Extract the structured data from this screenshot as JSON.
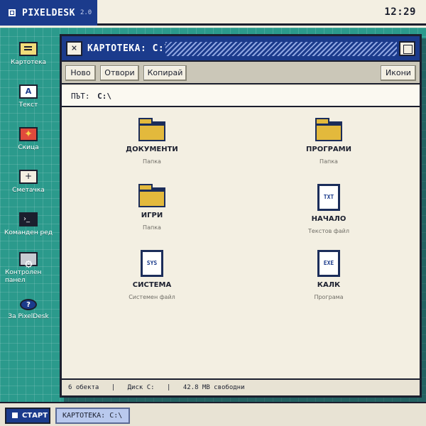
{
  "topbar": {
    "brand_name": "PIXELDESK",
    "brand_version": "2.0",
    "clock": "12:29"
  },
  "desktop": {
    "icons": [
      {
        "label": "Картотека",
        "icon": "folder-files-icon"
      },
      {
        "label": "Текст",
        "icon": "text-editor-icon",
        "glyph": "A"
      },
      {
        "label": "Скица",
        "icon": "sketch-icon",
        "glyph": "✦"
      },
      {
        "label": "Сметачка",
        "icon": "calculator-icon",
        "glyph": "+"
      },
      {
        "label": "Команден ред",
        "icon": "terminal-icon",
        "glyph": "›_"
      },
      {
        "label": "Контролен панел",
        "icon": "control-panel-icon"
      },
      {
        "label": "За PixelDesk",
        "icon": "about-icon",
        "glyph": "?"
      }
    ]
  },
  "window": {
    "title": "КАРТОТЕКА: C:\\",
    "close_glyph": "×",
    "toolbar": {
      "new_label": "Ново",
      "open_label": "Отвори",
      "copy_label": "Копирай",
      "view_label": "Икони"
    },
    "path": {
      "label": "ПЪТ:",
      "value": "C:\\"
    },
    "items": [
      {
        "name": "ДОКУМЕНТИ",
        "type": "Папка",
        "icon": "folder-icon"
      },
      {
        "name": "ПРОГРАМИ",
        "type": "Папка",
        "icon": "folder-icon"
      },
      {
        "name": "ИГРИ",
        "type": "Папка",
        "icon": "folder-icon"
      },
      {
        "name": "НАЧАЛО",
        "type": "Текстов файл",
        "icon": "txt-file-icon",
        "badge": "TXT"
      },
      {
        "name": "СИСТЕМА",
        "type": "Системен файл",
        "icon": "sys-file-icon",
        "badge": "SYS"
      },
      {
        "name": "КАЛК",
        "type": "Програма",
        "icon": "exe-file-icon",
        "badge": "EXE"
      }
    ],
    "status": {
      "count": "6 обекта",
      "disk": "Диск C:",
      "free": "42.8 MB свободни",
      "separator": "|"
    }
  },
  "taskbar": {
    "start_label": "СТАРТ",
    "task_label": "КАРТОТЕКА: C:\\"
  },
  "colors": {
    "accent": "#1b3b8c",
    "desktop": "#2b9a8c",
    "folder": "#e3b93c",
    "panel": "#f3efe2"
  }
}
